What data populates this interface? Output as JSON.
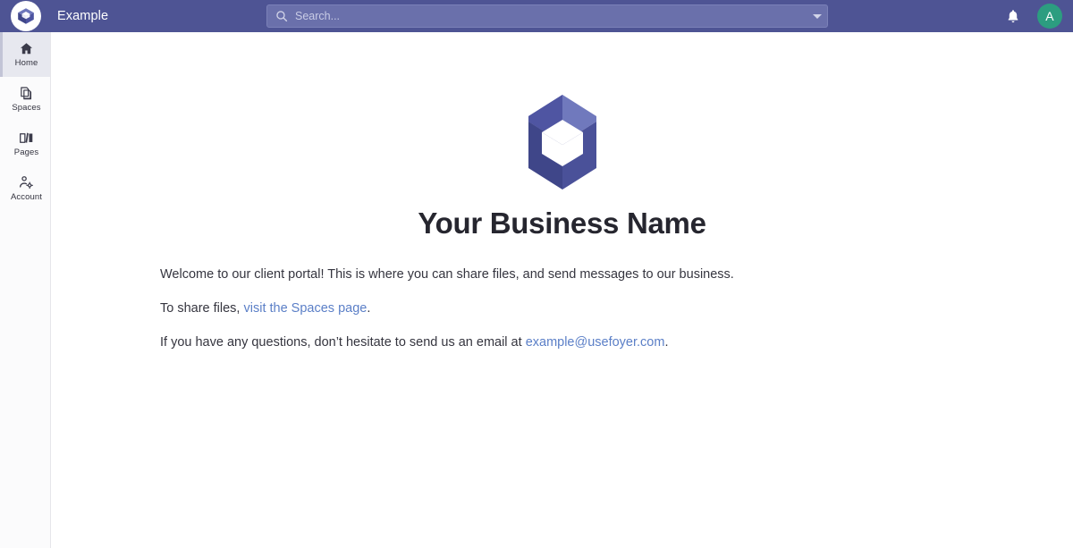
{
  "topbar": {
    "brand_logo_icon": "foyer-cube-logo-icon",
    "app_title": "Example",
    "search": {
      "icon": "search-icon",
      "value": "",
      "placeholder": "Search...",
      "caret_icon": "chevron-down-icon"
    },
    "notifications": {
      "icon": "bell-icon",
      "label": "Notifications"
    },
    "avatar": {
      "initial": "A",
      "color": "#2c9d80"
    },
    "background_color": "#4e5494"
  },
  "sidebar": {
    "items": [
      {
        "id": "home",
        "label": "Home",
        "icon": "home-icon",
        "active": true
      },
      {
        "id": "spaces",
        "label": "Spaces",
        "icon": "copy-documents-icon",
        "active": false
      },
      {
        "id": "pages",
        "label": "Pages",
        "icon": "open-book-icon",
        "active": false
      },
      {
        "id": "account",
        "label": "Account",
        "icon": "person-gear-icon",
        "active": false
      }
    ]
  },
  "main": {
    "hero_logo_icon": "foyer-cube-logo-large-icon",
    "title": "Your Business Name",
    "paragraph_1": "Welcome to our client portal! This is where you can share files, and send messages to our business.",
    "paragraph_2": {
      "prefix": "To share files, ",
      "link_text": "visit the Spaces page",
      "suffix": "."
    },
    "paragraph_3": {
      "prefix": "If you have any questions, don’t hesitate to send us an email at ",
      "link_text": "example@usefoyer.com",
      "suffix": "."
    }
  },
  "colors": {
    "header": "#4e5494",
    "link": "#5b7fc7",
    "avatar": "#2c9d80",
    "logo_light": "#7079bd",
    "logo_mid": "#4f55a2",
    "logo_dark": "#3d4488",
    "logo_darker": "#474e97",
    "sidebar_active": "#e7e8ef"
  }
}
